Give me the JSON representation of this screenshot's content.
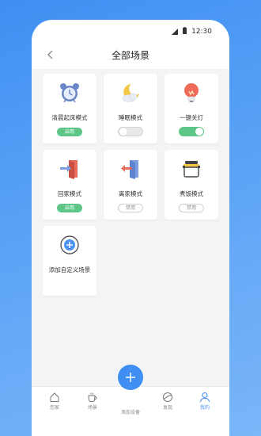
{
  "status": {
    "time": "12:30"
  },
  "header": {
    "title": "全部场景",
    "back_icon": "chevron-left-icon"
  },
  "scenes": [
    {
      "label": "清晨起床模式",
      "icon": "alarm-clock-icon",
      "control": "badge",
      "state": "启用",
      "enabled": true
    },
    {
      "label": "睡眠模式",
      "icon": "moon-cloud-icon",
      "control": "toggle",
      "enabled": false
    },
    {
      "label": "一键关灯",
      "icon": "light-bulb-icon",
      "control": "toggle",
      "enabled": true
    },
    {
      "label": "回家模式",
      "icon": "door-enter-icon",
      "control": "badge",
      "state": "启用",
      "enabled": true
    },
    {
      "label": "离家模式",
      "icon": "door-exit-icon",
      "control": "badge",
      "state": "禁用",
      "enabled": false
    },
    {
      "label": "煮饭模式",
      "icon": "rice-cooker-icon",
      "control": "badge",
      "state": "禁用",
      "enabled": false
    }
  ],
  "add_scene": {
    "label": "添加自定义场景",
    "icon": "add-circle-icon"
  },
  "nav": {
    "items": [
      {
        "label": "您家",
        "icon": "home-icon"
      },
      {
        "label": "场景",
        "icon": "cup-icon"
      },
      {
        "label": "添加设备",
        "icon": "plus-icon"
      },
      {
        "label": "发现",
        "icon": "discover-icon"
      },
      {
        "label": "我的",
        "icon": "user-icon",
        "active": true
      }
    ]
  },
  "colors": {
    "accent": "#3f8ff2",
    "enabled": "#5dc787",
    "background": "#f3f4f6"
  }
}
